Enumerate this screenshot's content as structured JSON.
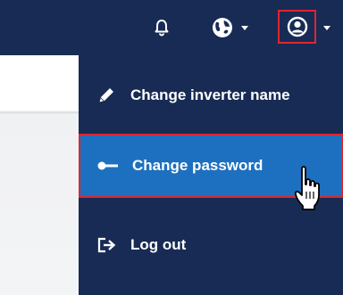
{
  "topbar": {
    "background": "#172b55",
    "notifications_icon": "bell-icon",
    "language_icon": "globe-icon",
    "user_icon": "user-circle-icon"
  },
  "user_menu": {
    "background": "#172b55",
    "highlight_color": "#1d70bf",
    "items": [
      {
        "label": "Change inverter name",
        "icon": "pencil-icon"
      },
      {
        "label": "Change password",
        "icon": "key-icon",
        "highlighted": true
      },
      {
        "label": "Log out",
        "icon": "logout-icon"
      }
    ]
  }
}
